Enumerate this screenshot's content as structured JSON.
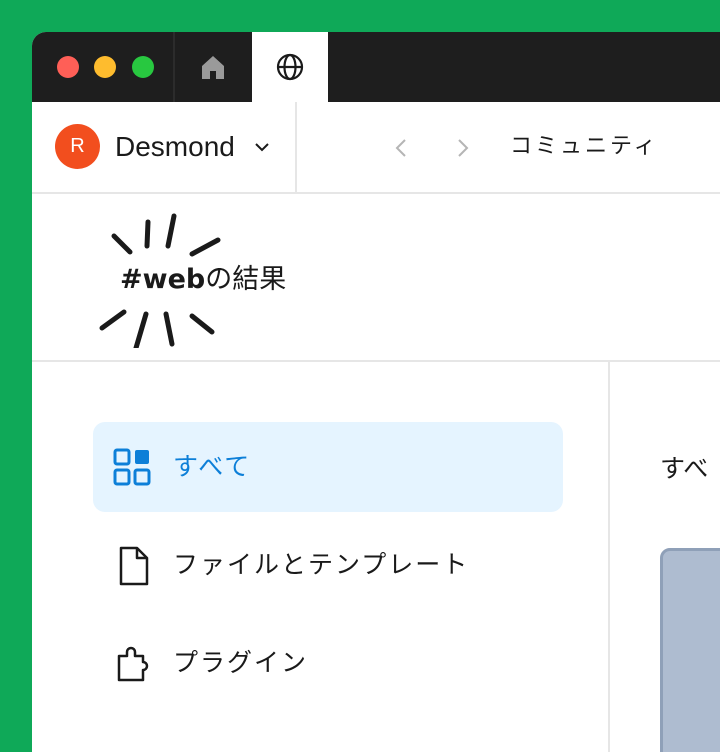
{
  "window": {
    "tabs": [
      {
        "icon": "home-icon",
        "active": false
      },
      {
        "icon": "globe-icon",
        "active": true
      }
    ]
  },
  "navbar": {
    "avatar_initial": "R",
    "avatar_color": "#f24e1e",
    "username": "Desmond",
    "breadcrumb": "コミュニティ"
  },
  "header": {
    "tag": "#web",
    "suffix": "の結果"
  },
  "sidebar": {
    "items": [
      {
        "label": "すべて",
        "icon": "grid-icon",
        "active": true
      },
      {
        "label": "ファイルとテンプレート",
        "icon": "file-icon",
        "active": false
      },
      {
        "label": "プラグイン",
        "icon": "puzzle-icon",
        "active": false
      }
    ]
  },
  "content": {
    "heading": "すべ"
  },
  "colors": {
    "background": "#0fa958",
    "accent": "#0d7fd8",
    "active_bg": "#e5f4ff"
  }
}
